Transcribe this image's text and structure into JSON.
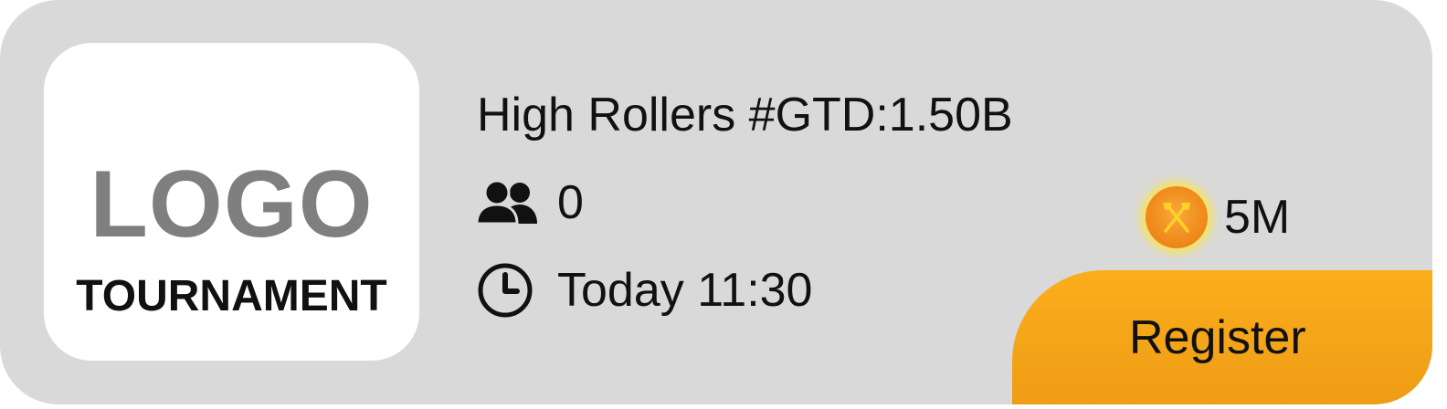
{
  "logo": {
    "text": "LOGO",
    "subtitle": "TOURNAMENT"
  },
  "tournament": {
    "title": "High Rollers #GTD:1.50B",
    "players": "0",
    "players_icon": "users-icon",
    "start_time": "Today 11:30",
    "start_icon": "clock-icon",
    "prize": "5M",
    "prize_icon": "coin-icon"
  },
  "actions": {
    "register_label": "Register"
  },
  "colors": {
    "card_background": "#d9d9d9",
    "logo_background": "#ffffff",
    "logo_text": "#7f7f7f",
    "register_button": "#fbae1c",
    "coin": "#f08a1c",
    "coin_glow": "#ffe63c"
  }
}
